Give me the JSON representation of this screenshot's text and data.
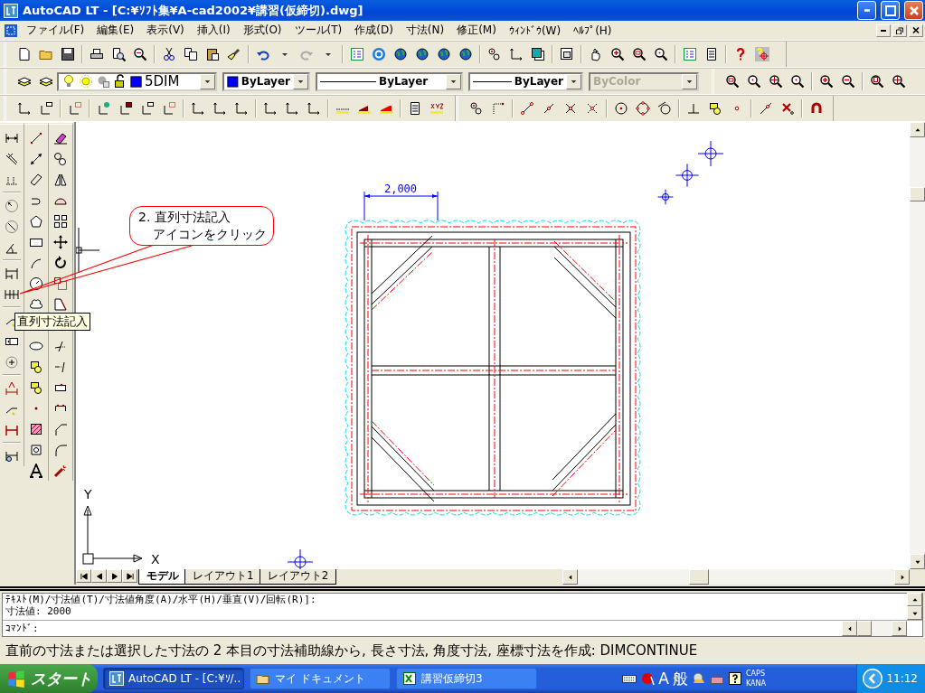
{
  "window": {
    "title": "AutoCAD LT - [C:¥ｿﾌﾄ集¥A-cad2002¥講習(仮締切).dwg]"
  },
  "menu": [
    "ファイル(F)",
    "編集(E)",
    "表示(V)",
    "挿入(I)",
    "形式(O)",
    "ツール(T)",
    "作成(D)",
    "寸法(N)",
    "修正(M)",
    "ｳｨﾝﾄﾞｳ(W)",
    "ﾍﾙﾌﾟ(H)"
  ],
  "properties_toolbar": {
    "layer": "5DIM",
    "color_control": "ByLayer",
    "linetype": "ByLayer",
    "lineweight": "ByLayer",
    "plot_style": {
      "value": "ByColor",
      "disabled": true
    }
  },
  "drawing": {
    "dimension": "2,000",
    "axis_x": "X",
    "axis_y": "Y"
  },
  "callout": {
    "lines": [
      "2. 直列寸法記入",
      "アイコンをクリック"
    ]
  },
  "tooltip": {
    "text": "直列寸法記入"
  },
  "layout_tabs": [
    {
      "label": "モデル",
      "selected": true
    },
    {
      "label": "レイアウト1",
      "selected": false
    },
    {
      "label": "レイアウト2",
      "selected": false
    }
  ],
  "command_history": [
    "ﾃｷｽﾄ(M)/寸法値(T)/寸法値角度(A)/水平(H)/垂直(V)/回転(R)]:",
    "寸法値: 2000"
  ],
  "command_prompt": "ｺﾏﾝﾄﾞ:",
  "status_bar": {
    "text": "直前の寸法または選択した寸法の 2 本目の寸法補助線から, 長さ寸法, 角度寸法, 座標寸法を作成:  DIMCONTINUE"
  },
  "taskbar": {
    "start": "スタート",
    "tasks": [
      {
        "label": "AutoCAD LT - [C:¥ｿ/..",
        "selected": true
      },
      {
        "label": "マイ ドキュメント",
        "selected": false
      },
      {
        "label": "講習仮締切3",
        "selected": false
      }
    ],
    "ime": [
      "A",
      "般"
    ],
    "indicators": [
      "CAPS",
      "KANA"
    ],
    "clock": "11:12"
  }
}
